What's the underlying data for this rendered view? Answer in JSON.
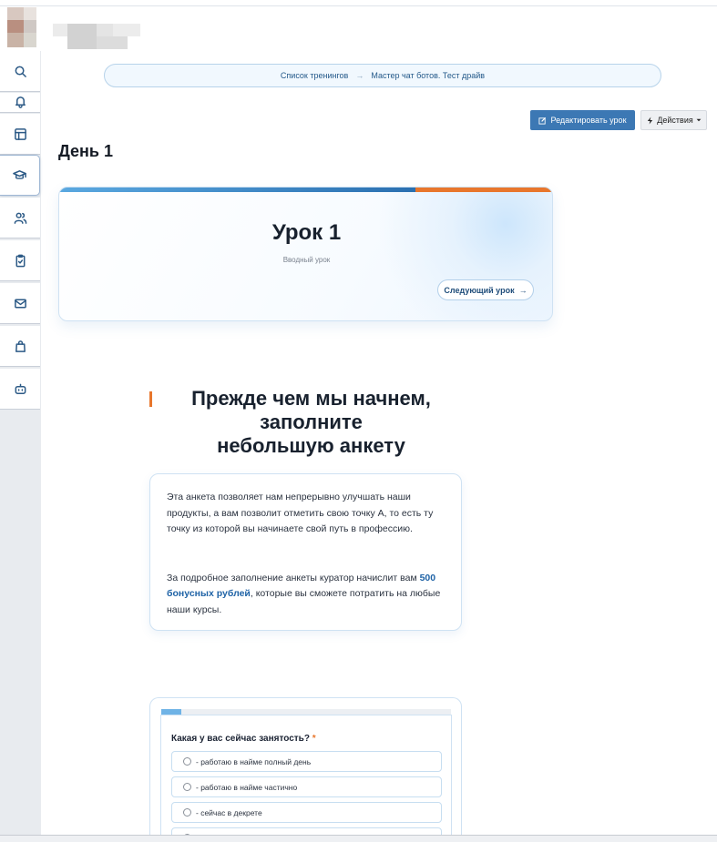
{
  "sidebar": {
    "items": [
      {
        "icon": "search-icon"
      },
      {
        "icon": "bell-icon"
      },
      {
        "icon": "layout-icon"
      },
      {
        "icon": "graduation-cap-icon",
        "active": true
      },
      {
        "icon": "users-icon"
      },
      {
        "icon": "clipboard-check-icon"
      },
      {
        "icon": "mail-icon"
      },
      {
        "icon": "shopping-bag-icon"
      },
      {
        "icon": "bot-icon"
      }
    ]
  },
  "breadcrumb": {
    "parent": "Список тренингов",
    "separator": "→",
    "current": "Мастер чат ботов. Тест драйв"
  },
  "toolbar": {
    "edit_label": "Редактировать урок",
    "actions_label": "Действия"
  },
  "day_title": "День 1",
  "lesson": {
    "title": "Урок 1",
    "subtitle": "Вводный урок",
    "next_label": "Следующий урок"
  },
  "section": {
    "heading_line1": "Прежде чем мы начнем,",
    "heading_line2": "заполните",
    "heading_line3": "небольшую анкету",
    "paragraph1": "Эта анкета позволяет нам непрерывно улучшать наши продукты, а вам позволит отметить свою точку А, то есть ту точку из которой вы начинаете свой путь в профессию.",
    "paragraph2_before": "За подробное заполнение анкеты куратор начислит вам ",
    "paragraph2_highlight": "500 бонусных рублей",
    "paragraph2_after": ", которые вы сможете потратить на любые наши курсы."
  },
  "form": {
    "progress": 0.07,
    "question": "Какая у вас сейчас занятость?",
    "required_mark": "*",
    "options": [
      "- работаю в найме полный день",
      "- работаю в найме частично",
      "- сейчас в декрете"
    ]
  },
  "colors": {
    "accent_blue": "#3c78b4",
    "accent_orange": "#e8762c",
    "highlight": "#1f63a6"
  }
}
